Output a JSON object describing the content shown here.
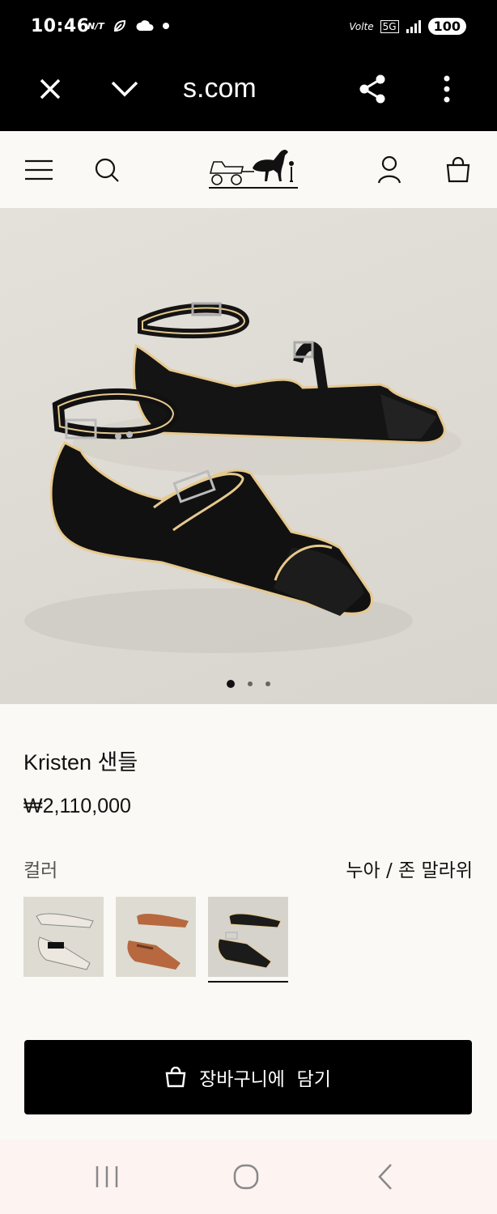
{
  "status_bar": {
    "time": "10:46",
    "notifications": [
      "app-notification-icon",
      "leaf-icon",
      "cloud-icon",
      "dot"
    ],
    "network_label": "Volte",
    "network_type": "5G",
    "battery": "100"
  },
  "browser": {
    "url_text": "s.com",
    "icons": [
      "close-icon",
      "chevron-down-icon",
      "share-icon",
      "more-vertical-icon"
    ]
  },
  "site_header": {
    "icons": [
      "menu-icon",
      "search-icon",
      "carriage-logo",
      "account-icon",
      "shopping-bag-icon"
    ]
  },
  "gallery": {
    "image_count": 3,
    "active_index": 0
  },
  "product": {
    "title": "Kristen 샌들",
    "price": "₩2,110,000",
    "color_label": "컬러",
    "color_value": "누아 / 존 말라위",
    "swatches": [
      {
        "name": "cream-variant",
        "selected": false,
        "color": "#ece8df"
      },
      {
        "name": "tan-variant",
        "selected": false,
        "color": "#b7683e"
      },
      {
        "name": "black-variant",
        "selected": true,
        "color": "#1b1b1b"
      }
    ]
  },
  "cta": {
    "add_to_cart_label": "장바구니에  담기"
  },
  "colors": {
    "background": "#fbf9f5",
    "bar": "#000000",
    "navbar": "#fdf3f1"
  }
}
